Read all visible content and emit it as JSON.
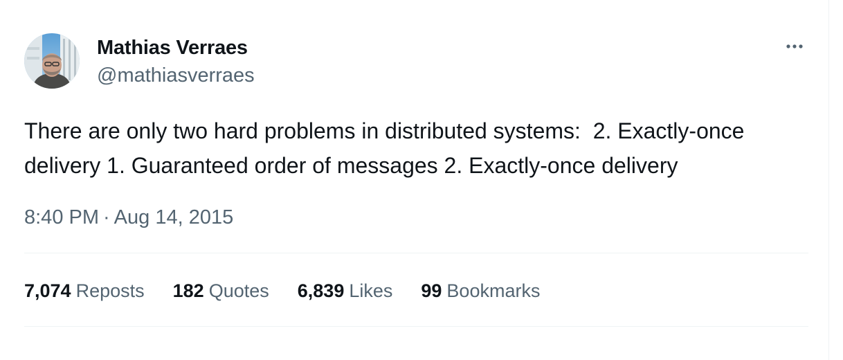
{
  "author": {
    "name": "Mathias Verraes",
    "handle": "@mathiasverraes",
    "avatar_icon": "profile-photo"
  },
  "more_icon": "more-horizontal-icon",
  "tweet": {
    "text": "There are only two hard problems in distributed systems:  2. Exactly-once delivery 1. Guaranteed order of messages 2. Exactly-once delivery",
    "time": "8:40 PM",
    "separator": "·",
    "date": "Aug 14, 2015"
  },
  "stats": {
    "reposts": {
      "count": "7,074",
      "label": "Reposts"
    },
    "quotes": {
      "count": "182",
      "label": "Quotes"
    },
    "likes": {
      "count": "6,839",
      "label": "Likes"
    },
    "bookmarks": {
      "count": "99",
      "label": "Bookmarks"
    }
  },
  "colors": {
    "text_primary": "#0f1419",
    "text_secondary": "#536471",
    "divider": "#eff3f4"
  }
}
